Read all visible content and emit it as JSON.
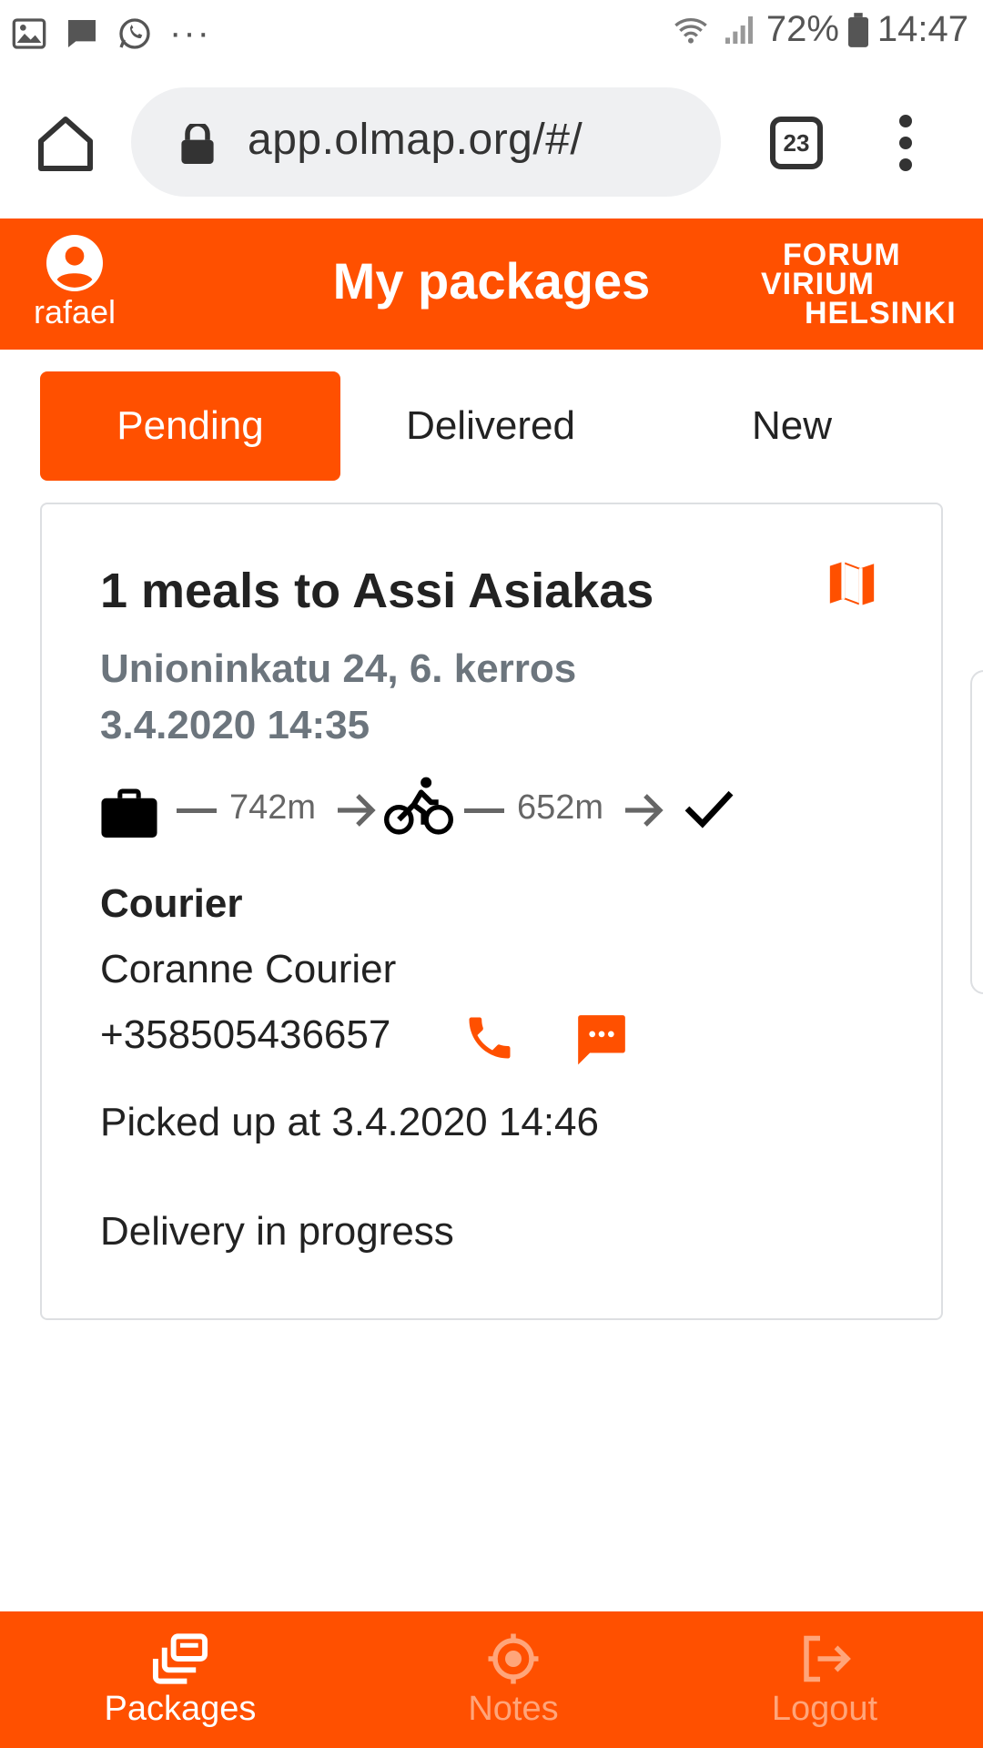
{
  "status_bar": {
    "battery": "72%",
    "time": "14:47",
    "icons": [
      "gallery-icon",
      "message-icon",
      "whatsapp-icon",
      "more-dots-icon",
      "wifi-icon",
      "signal-icon",
      "battery-icon"
    ],
    "more": "···"
  },
  "browser": {
    "url": "app.olmap.org/#/",
    "tab_count": "23",
    "icons": [
      "home-icon",
      "lock-icon",
      "tabs-icon",
      "menu-icon"
    ]
  },
  "header": {
    "username": "rafael",
    "title": "My packages",
    "logo_lines": [
      "FORUM",
      "VIRIUM",
      "HELSINKI"
    ],
    "accent": "#ff5000"
  },
  "tabs": [
    {
      "label": "Pending",
      "active": true
    },
    {
      "label": "Delivered",
      "active": false
    },
    {
      "label": "New",
      "active": false
    }
  ],
  "package": {
    "title": "1 meals to Assi Asiakas",
    "address": "Unioninkatu 24, 6. kerros",
    "datetime": "3.4.2020 14:35",
    "route": {
      "pickup_distance": "742m",
      "delivery_distance": "652m",
      "icons": [
        "briefcase-icon",
        "arrow-right-icon",
        "bicycle-icon",
        "check-icon"
      ]
    },
    "courier_label": "Courier",
    "courier_name": "Coranne Courier",
    "courier_phone": "+358505436657",
    "picked_up": "Picked up at 3.4.2020 14:46",
    "status": "Delivery in progress"
  },
  "bottom_nav": [
    {
      "label": "Packages",
      "icon": "packages-icon",
      "active": true
    },
    {
      "label": "Notes",
      "icon": "target-icon",
      "active": false
    },
    {
      "label": "Logout",
      "icon": "logout-icon",
      "active": false
    }
  ],
  "colors": {
    "accent": "#ff5000",
    "muted_text": "#6c757d",
    "inactive_nav": "#ffa57a"
  }
}
